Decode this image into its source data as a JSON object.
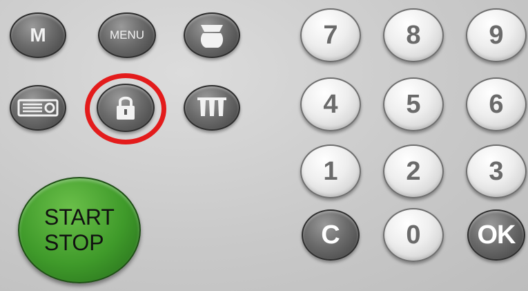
{
  "left_buttons": {
    "m_label": "M",
    "menu_label": "MENU"
  },
  "start_stop": {
    "line1": "START",
    "line2": "STOP"
  },
  "keypad": {
    "keys": [
      "7",
      "8",
      "9",
      "4",
      "5",
      "6",
      "1",
      "2",
      "3"
    ],
    "clear_label": "C",
    "zero_label": "0",
    "ok_label": "OK"
  },
  "icons": [
    "bowl-icon",
    "display-icon",
    "lock-icon",
    "lamps-icon"
  ],
  "colors": {
    "highlight_ring": "#e31b1b",
    "start_button": "#3f9a2a"
  }
}
